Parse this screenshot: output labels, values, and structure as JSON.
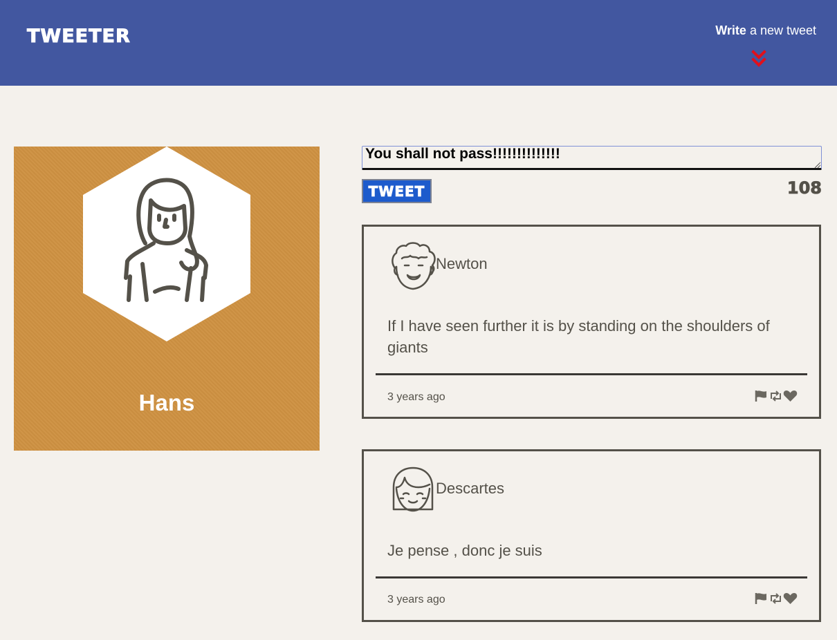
{
  "nav": {
    "brand": "TWEETER",
    "compose_bold": "Write",
    "compose_rest": " a new tweet",
    "chevron_icon": "double-chevron-down-icon",
    "chevron_color": "#e0101c"
  },
  "profile": {
    "name": "Hans",
    "avatar_icon": "woman-avatar-icon",
    "background_color": "#cf9242"
  },
  "composer": {
    "input_value": "You shall not pass!!!!!!!!!!!!!!",
    "button_label": "TWEET",
    "remaining_chars": "108"
  },
  "tweets": [
    {
      "author": "Newton",
      "avatar_icon": "curly-hair-man-avatar-icon",
      "content": "If I have seen further it is by standing on the shoulders of giants",
      "time": "3 years ago",
      "actions": [
        "flag-icon",
        "retweet-icon",
        "heart-icon"
      ]
    },
    {
      "author": "Descartes",
      "avatar_icon": "bangs-girl-avatar-icon",
      "content": "Je pense , donc je suis",
      "time": "3 years ago",
      "actions": [
        "flag-icon",
        "retweet-icon",
        "heart-icon"
      ]
    }
  ],
  "colors": {
    "nav_bg": "#4257a0",
    "page_bg": "#f4f1ec",
    "text": "#545149",
    "button_bg": "#1d5bcc"
  }
}
